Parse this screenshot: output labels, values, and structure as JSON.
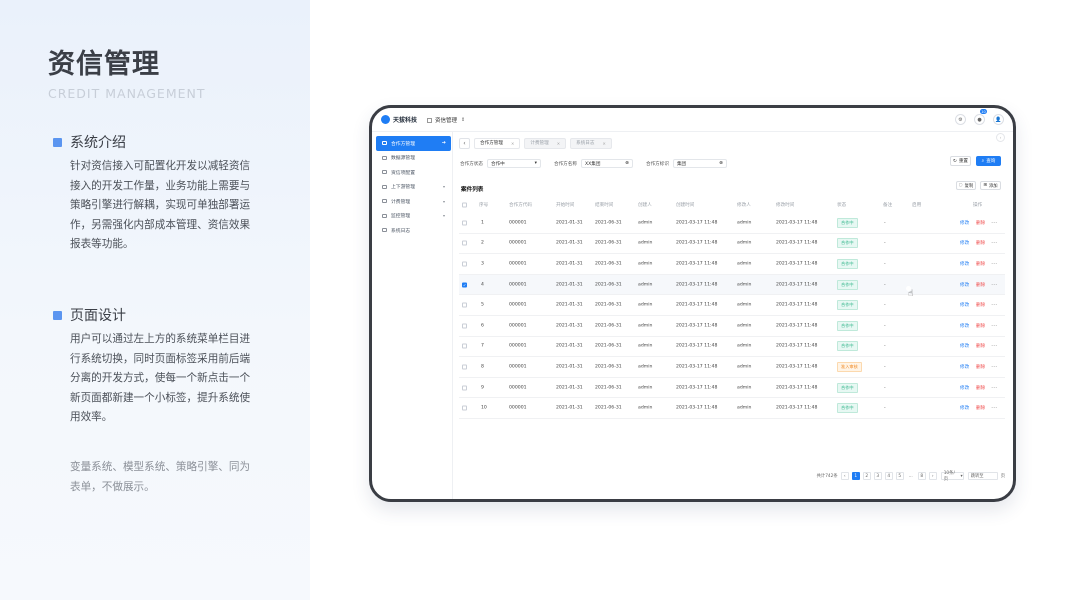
{
  "slide": {
    "title": "资信管理",
    "subtitle": "CREDIT MANAGEMENT",
    "sections": [
      {
        "heading": "系统介绍",
        "body": "针对资信接入可配置化开发以减轻资信接入的开发工作量，业务功能上需要与策略引擎进行解耦，实现可单独部署运作，另需强化内部成本管理、资信效果报表等功能。"
      },
      {
        "heading": "页面设计",
        "body": "用户可以通过左上方的系统菜单栏目进行系统切换，同时页面标签采用前后端分离的开发方式，使每一个新点击一个新页面都新建一个小标签，提升系统使用效率。"
      }
    ],
    "note": "变量系统、模型系统、策略引擎、同为表单，不做展示。"
  },
  "app": {
    "logo_text": "天拔科技",
    "menu_label": "资信管理",
    "notification_count": "10",
    "icons": [
      "settings-icon",
      "message-icon",
      "user-icon"
    ]
  },
  "sidebar": {
    "items": [
      {
        "label": "合作方管理",
        "icon": "partner-icon",
        "active": true
      },
      {
        "label": "数据源管理",
        "icon": "datasource-icon"
      },
      {
        "label": "资信项配置",
        "icon": "config-icon"
      },
      {
        "label": "上下游管理",
        "icon": "flow-icon",
        "expand": true
      },
      {
        "label": "计费管理",
        "icon": "billing-icon",
        "expand": true
      },
      {
        "label": "监控管理",
        "icon": "monitor-icon",
        "expand": true
      },
      {
        "label": "系统日志",
        "icon": "log-icon"
      }
    ]
  },
  "tabs": [
    {
      "label": "合作方管理",
      "active": true
    },
    {
      "label": "计费管理",
      "active": false
    },
    {
      "label": "系统日志",
      "active": false
    }
  ],
  "filters": {
    "status_label": "合作方状态",
    "status_value": "合作中",
    "name_label": "合作方名称",
    "name_value": "XX集团",
    "id_label": "合作方标识",
    "id_value": "集团",
    "reset_label": "重置",
    "query_label": "查询"
  },
  "list": {
    "title": "案件列表",
    "copy_label": "复制",
    "add_label": "添加",
    "columns": [
      "序号",
      "合作方代码",
      "开始时间",
      "结束时间",
      "创建人",
      "创建时间",
      "修改人",
      "修改时间",
      "状态",
      "备注",
      "启用",
      "操作"
    ],
    "rows": [
      {
        "no": "1",
        "code": "000001",
        "start": "2021-01-31",
        "end": "2021-06-31",
        "creator": "admin",
        "created": "2021-03-17 11:48",
        "modifier": "admin",
        "modified": "2021-03-17 11:48",
        "status": "合作中",
        "status_type": "ok",
        "remark": "-",
        "enabled": true,
        "checked": false
      },
      {
        "no": "2",
        "code": "000001",
        "start": "2021-01-31",
        "end": "2021-06-31",
        "creator": "admin",
        "created": "2021-03-17 11:48",
        "modifier": "admin",
        "modified": "2021-03-17 11:48",
        "status": "合作中",
        "status_type": "ok",
        "remark": "-",
        "enabled": true,
        "checked": false
      },
      {
        "no": "3",
        "code": "000001",
        "start": "2021-01-31",
        "end": "2021-06-31",
        "creator": "admin",
        "created": "2021-03-17 11:48",
        "modifier": "admin",
        "modified": "2021-03-17 11:48",
        "status": "合作中",
        "status_type": "ok",
        "remark": "-",
        "enabled": true,
        "checked": false
      },
      {
        "no": "4",
        "code": "000001",
        "start": "2021-01-31",
        "end": "2021-06-31",
        "creator": "admin",
        "created": "2021-03-17 11:48",
        "modifier": "admin",
        "modified": "2021-03-17 11:48",
        "status": "合作中",
        "status_type": "ok",
        "remark": "-",
        "enabled": true,
        "checked": true
      },
      {
        "no": "5",
        "code": "000001",
        "start": "2021-01-31",
        "end": "2021-06-31",
        "creator": "admin",
        "created": "2021-03-17 11:48",
        "modifier": "admin",
        "modified": "2021-03-17 11:48",
        "status": "合作中",
        "status_type": "ok",
        "remark": "-",
        "enabled": true,
        "checked": false
      },
      {
        "no": "6",
        "code": "000001",
        "start": "2021-01-31",
        "end": "2021-06-31",
        "creator": "admin",
        "created": "2021-03-17 11:48",
        "modifier": "admin",
        "modified": "2021-03-17 11:48",
        "status": "合作中",
        "status_type": "ok",
        "remark": "-",
        "enabled": true,
        "checked": false
      },
      {
        "no": "7",
        "code": "000001",
        "start": "2021-01-31",
        "end": "2021-06-31",
        "creator": "admin",
        "created": "2021-03-17 11:48",
        "modifier": "admin",
        "modified": "2021-03-17 11:48",
        "status": "合作中",
        "status_type": "ok",
        "remark": "-",
        "enabled": false,
        "checked": false
      },
      {
        "no": "8",
        "code": "000001",
        "start": "2021-01-31",
        "end": "2021-06-31",
        "creator": "admin",
        "created": "2021-03-17 11:48",
        "modifier": "admin",
        "modified": "2021-03-17 11:48",
        "status": "准入审核",
        "status_type": "warn",
        "remark": "-",
        "enabled": true,
        "checked": false
      },
      {
        "no": "9",
        "code": "000001",
        "start": "2021-01-31",
        "end": "2021-06-31",
        "creator": "admin",
        "created": "2021-03-17 11:48",
        "modifier": "admin",
        "modified": "2021-03-17 11:48",
        "status": "合作中",
        "status_type": "ok",
        "remark": "-",
        "enabled": true,
        "checked": false
      },
      {
        "no": "10",
        "code": "000001",
        "start": "2021-01-31",
        "end": "2021-06-31",
        "creator": "admin",
        "created": "2021-03-17 11:48",
        "modifier": "admin",
        "modified": "2021-03-17 11:48",
        "status": "合作中",
        "status_type": "ok",
        "remark": "-",
        "enabled": true,
        "checked": false
      }
    ],
    "edit_label": "修改",
    "delete_label": "删除"
  },
  "pagination": {
    "total": "共计742条",
    "pages": [
      "1",
      "2",
      "3",
      "4",
      "5",
      "...",
      "8"
    ],
    "current": "1",
    "page_size": "10条/页",
    "jump_label": "跳转至",
    "jump_suffix": "页"
  },
  "colors": {
    "accent": "#1f7df4",
    "success": "#20b25b",
    "danger": "#f04a4a",
    "warning": "#f08a24"
  }
}
